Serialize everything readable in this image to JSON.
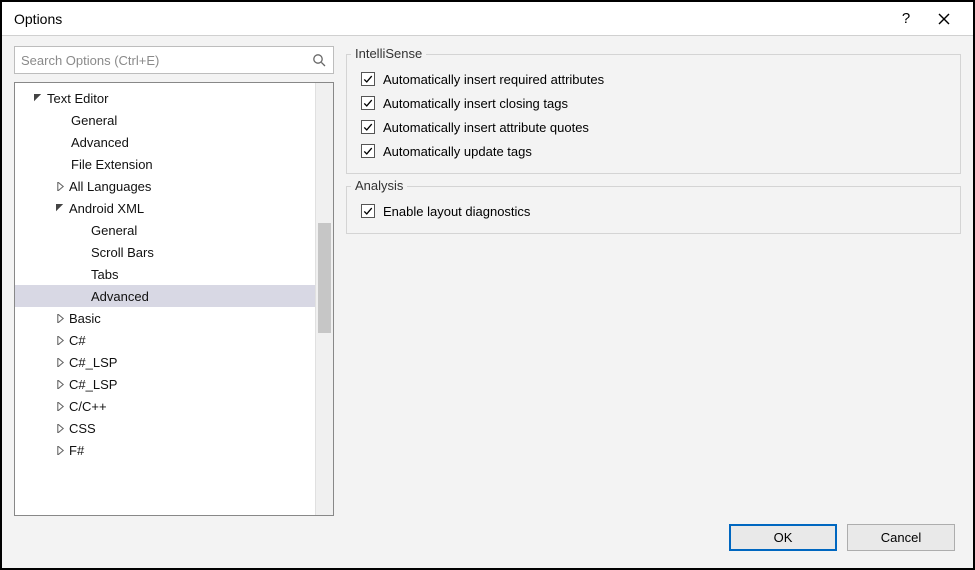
{
  "title": "Options",
  "search": {
    "placeholder": "Search Options (Ctrl+E)"
  },
  "tree": {
    "text_editor": "Text Editor",
    "general": "General",
    "advanced": "Advanced",
    "file_ext": "File Extension",
    "all_lang": "All Languages",
    "android_xml": "Android XML",
    "ax_general": "General",
    "ax_scroll": "Scroll Bars",
    "ax_tabs": "Tabs",
    "ax_advanced": "Advanced",
    "basic": "Basic",
    "csharp": "C#",
    "csharp_lsp1": "C#_LSP",
    "csharp_lsp2": "C#_LSP",
    "ccpp": "C/C++",
    "css": "CSS",
    "fsharp": "F#"
  },
  "groups": {
    "intellisense": {
      "title": "IntelliSense",
      "items": [
        "Automatically insert required attributes",
        "Automatically insert closing tags",
        "Automatically insert attribute quotes",
        "Automatically update tags"
      ]
    },
    "analysis": {
      "title": "Analysis",
      "items": [
        "Enable layout diagnostics"
      ]
    }
  },
  "buttons": {
    "ok": "OK",
    "cancel": "Cancel"
  }
}
